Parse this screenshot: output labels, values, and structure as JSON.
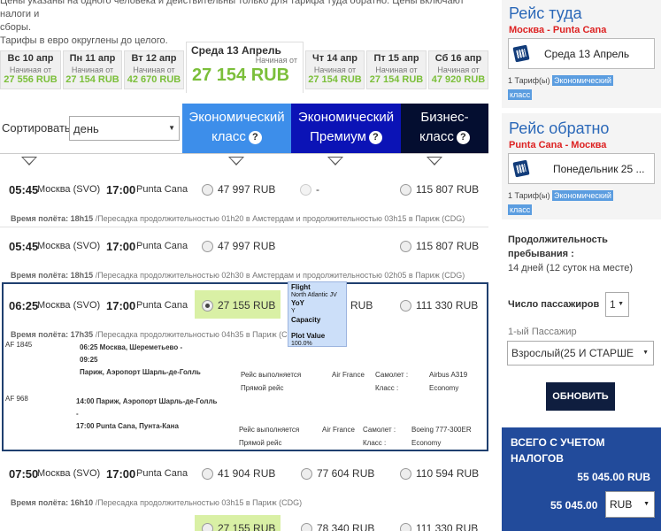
{
  "notice": {
    "line1": "Цены указаны на одного человека и действительны только для тарифа туда обратно. Цены включают налоги и",
    "line2": "сборы.",
    "line3": "Тарифы в евро округлены до целого."
  },
  "dates": [
    {
      "label": "Вс 10 апр",
      "from": "Начиная от",
      "price": "27 556 RUB"
    },
    {
      "label": "Пн 11 апр",
      "from": "Начиная от",
      "price": "27 154 RUB"
    },
    {
      "label": "Вт 12 апр",
      "from": "Начиная от",
      "price": "42 670 RUB"
    },
    {
      "label": "Чт 14 апр",
      "from": "Начиная от",
      "price": "27 154 RUB"
    },
    {
      "label": "Пт 15 апр",
      "from": "Начиная от",
      "price": "27 154 RUB"
    },
    {
      "label": "Сб 16 апр",
      "from": "Начиная от",
      "price": "47 920 RUB"
    }
  ],
  "selected_date": {
    "label": "Среда 13 Апрель",
    "from": "Начиная от",
    "price": "27 154 RUB"
  },
  "sort": {
    "label": "Сортировать:",
    "value": "день"
  },
  "classes": {
    "economy": {
      "line1": "Экономический",
      "line2": "класс"
    },
    "premium": {
      "line1": "Экономический",
      "line2": "Премиум"
    },
    "business": {
      "line1": "Бизнес-",
      "line2": "класс"
    },
    "help": "?"
  },
  "flights": [
    {
      "dep_time": "05:45",
      "dep_city": "Москва (SVO)",
      "arr_time": "17:00",
      "arr_city": "Punta Cana",
      "eco": "47 997 RUB",
      "prem": "-",
      "bus": "115 807 RUB",
      "dur_label": "Время полёта:",
      "dur": "18h15",
      "detail": "/Пересадка продолжительностью 01h20 в Амстердам и продолжительностью 03h15 в Париж (CDG)"
    },
    {
      "dep_time": "05:45",
      "dep_city": "Москва (SVO)",
      "arr_time": "17:00",
      "arr_city": "Punta Cana",
      "eco": "47 997 RUB",
      "prem": "",
      "bus": "115 807 RUB",
      "dur_label": "Время полёта:",
      "dur": "18h15",
      "detail": "/Пересадка продолжительностью 02h30 в Амстердам и продолжительностью 02h05 в Париж (CDG)"
    },
    {
      "dep_time": "06:25",
      "dep_city": "Москва (SVO)",
      "arr_time": "17:00",
      "arr_city": "Punta Cana",
      "eco": "27 155 RUB",
      "prem": "RUB",
      "bus": "111 330 RUB",
      "dur_label": "Время полёта:",
      "dur": "17h35",
      "detail": "/Пересадка продолжительностью 04h35 в Париж (CDG)"
    },
    {
      "dep_time": "07:50",
      "dep_city": "Москва (SVO)",
      "arr_time": "17:00",
      "arr_city": "Punta Cana",
      "eco": "41 904 RUB",
      "prem": "77 604 RUB",
      "bus": "110 594 RUB",
      "dur_label": "Время полёта:",
      "dur": "16h10",
      "detail": "/Пересадка продолжительностью 03h15 в Париж (CDG)"
    },
    {
      "eco": "27 155 RUB",
      "prem": "78 340 RUB",
      "bus": "111 330 RUB"
    }
  ],
  "segments": [
    {
      "flight": "AF 1845",
      "dep": "06:25 Москва, Шереметьево -",
      "arr_time": "09:25",
      "arr": "Париж, Аэропорт Шарль-де-Голль",
      "operated_label": "Рейс выполняется",
      "direct": "Прямой рейс",
      "carrier": "Air France",
      "plane_label": "Самолет :",
      "plane": "Airbus A319",
      "class_label": "Класс :",
      "class": "Economy"
    },
    {
      "flight": "AF 968",
      "dep": "14:00 Париж, Аэропорт Шарль-де-Голль",
      "dash": "-",
      "arr": "17:00 Punta Cana, Пунта-Кана",
      "operated_label": "Рейс выполняется",
      "direct": "Прямой рейс",
      "carrier": "Air France",
      "plane_label": "Самолет :",
      "plane": "Boeing 777-300ER",
      "class_label": "Класс :",
      "class": "Economy"
    }
  ],
  "tooltip": {
    "flight_label": "Flight",
    "flight": "North Atlantic JV",
    "yoy_label": "YoY",
    "yoy": "Y",
    "capacity_label": "Capacity",
    "plot_label": "Plot Value",
    "plot": "100.0%"
  },
  "sidebar": {
    "out_title": "Рейс туда",
    "out_route": "Москва - Punta Cana",
    "out_date": "Среда 13 Апрель",
    "out_tariff": "1 Тариф(ы)",
    "out_tag1": "Экономический",
    "out_tag2": "класс",
    "ret_title": "Рейс обратно",
    "ret_route": "Punta Cana - Москва",
    "ret_date": "Понедельник 25 ...",
    "ret_tariff": "1 Тариф(ы)",
    "ret_tag1": "Экономический",
    "ret_tag2": "класс",
    "stay_label1": "Продолжительность",
    "stay_label2": "пребывания :",
    "stay_value": "14 дней (12 суток на месте)",
    "pax_label": "Число пассажиров",
    "pax_value": "1",
    "pax1_label": "1-ый Пассажир",
    "pax1_value": "Взрослый(25 И СТАРШЕ",
    "update": "ОБНОВИТЬ",
    "total_line1": "ВСЕГО С УЧЕТОМ",
    "total_line2": "НАЛОГОВ",
    "total_rub": "55 045.00 RUB",
    "total_value": "55 045.00",
    "currency": "RUB"
  },
  "colors": {
    "economy": "#3d8eea",
    "premium": "#0b13b6",
    "business": "#040e30",
    "price_green": "#7bbf3a",
    "highlight": "#d9f0a5",
    "total_bg": "#224b9b",
    "title_blue": "#2b68b8",
    "route_red": "#dd2222"
  }
}
